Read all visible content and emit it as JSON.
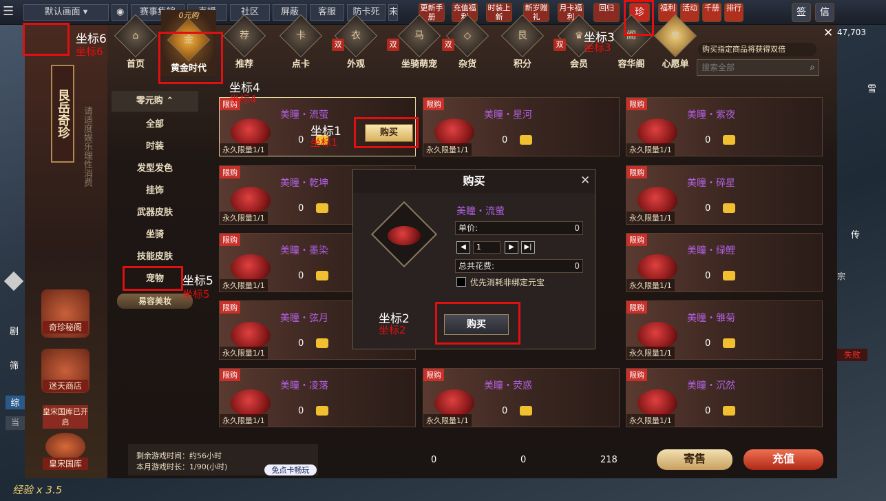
{
  "topbar": {
    "menu": "☰",
    "view": "默认画面",
    "links": [
      "赛事集锦",
      "直播",
      "社区",
      "屏蔽",
      "客服",
      "防卡死"
    ],
    "trunc": "未",
    "events": [
      "更新手册",
      "充值福利",
      "时装上新",
      "新岁赠礼",
      "月卡福利",
      "回归"
    ],
    "treasure": "珍",
    "tabs2": [
      "福利",
      "活动",
      "千册",
      "排行",
      "签",
      "信"
    ]
  },
  "window": {
    "close": "✕",
    "currency": "47,703",
    "nav": [
      {
        "k": "首页",
        "i": "⌂"
      },
      {
        "k": "黄金时代",
        "i": "金",
        "sub": "0元购"
      },
      {
        "k": "推荐",
        "i": "荐"
      },
      {
        "k": "点卡",
        "i": "卡"
      },
      {
        "k": "外观",
        "i": "衣"
      },
      {
        "k": "坐骑萌宠",
        "i": "马"
      },
      {
        "k": "杂货",
        "i": "◇"
      },
      {
        "k": "积分",
        "i": "艮"
      },
      {
        "k": "会员",
        "i": "♛"
      },
      {
        "k": "容华阁",
        "i": "阁"
      },
      {
        "k": "心愿单",
        "i": "♥"
      }
    ],
    "double": "双",
    "promo": "购买指定商品将获得双倍",
    "search_placeholder": "搜索全部",
    "banner": {
      "title": "艮岳奇珍",
      "notice": "请适度娱乐理性消费",
      "btns": [
        "奇珍秘阁",
        "迷天商店",
        "皇宋国库"
      ],
      "status": "皇宋国库已开启"
    },
    "categories": {
      "head": "零元购",
      "items": [
        "全部",
        "时装",
        "发型发色",
        "挂饰",
        "武器皮肤",
        "坐骑",
        "技能皮肤",
        "宠物",
        "易容美妆"
      ]
    },
    "items": [
      {
        "tag": "限购",
        "name": "美瞳・流萤",
        "price": "0",
        "limit": "永久限量1/1",
        "buy": "购买"
      },
      {
        "tag": "限购",
        "name": "美瞳・星河",
        "price": "0",
        "limit": "永久限量1/1"
      },
      {
        "tag": "限购",
        "name": "美瞳・紫夜",
        "price": "0",
        "limit": "永久限量1/1"
      },
      {
        "tag": "限购",
        "name": "美瞳・乾坤",
        "price": "0",
        "limit": "永久限量1/1"
      },
      {
        "tag": "限购",
        "name": "美瞳・碎星",
        "price": "0",
        "limit": "永久限量1/1"
      },
      {
        "tag": "限购",
        "name": "美瞳・墨染",
        "price": "0",
        "limit": "永久限量1/1"
      },
      {
        "tag": "限购",
        "name": "美瞳・绿鲤",
        "price": "0",
        "limit": "永久限量1/1"
      },
      {
        "tag": "限购",
        "name": "美瞳・弦月",
        "price": "0",
        "limit": "永久限量1/1"
      },
      {
        "tag": "限购",
        "name": "美瞳・雏菊",
        "price": "0",
        "limit": "永久限量1/1"
      },
      {
        "tag": "限购",
        "name": "美瞳・凌落",
        "price": "0",
        "limit": "永久限量1/1"
      },
      {
        "tag": "限购",
        "name": "美瞳・荧惑",
        "price": "0",
        "limit": "永久限量1/1"
      },
      {
        "tag": "限购",
        "name": "美瞳・沉然",
        "price": "0",
        "limit": "永久限量1/1"
      }
    ],
    "dialog": {
      "title": "购买",
      "name": "美瞳・流萤",
      "unit_label": "单价:",
      "unit": "0",
      "qty": "1",
      "total_label": "总共花费:",
      "total": "0",
      "prefer": "优先消耗非绑定元宝",
      "buy": "购买",
      "close": "✕"
    },
    "footer": {
      "remain": "剩余游戏时间：约56小时",
      "month": "本月游戏时长：1/90(小时)",
      "card": "免点卡畅玩",
      "bal1": "0",
      "bal2": "0",
      "bal3": "218",
      "sell": "寄售",
      "recharge": "充值"
    }
  },
  "marks": [
    {
      "t": "坐标1"
    },
    {
      "t": "坐标2"
    },
    {
      "t": "坐标3"
    },
    {
      "t": "坐标4"
    },
    {
      "t": "坐标5"
    },
    {
      "t": "坐标6"
    }
  ],
  "side": {
    "left": [
      "剧",
      "筛",
      "综",
      "当"
    ],
    "exp": "经验 x 3.5",
    "right": [
      "雪",
      "传"
    ],
    "fail": "失败",
    "zong": "宗"
  }
}
